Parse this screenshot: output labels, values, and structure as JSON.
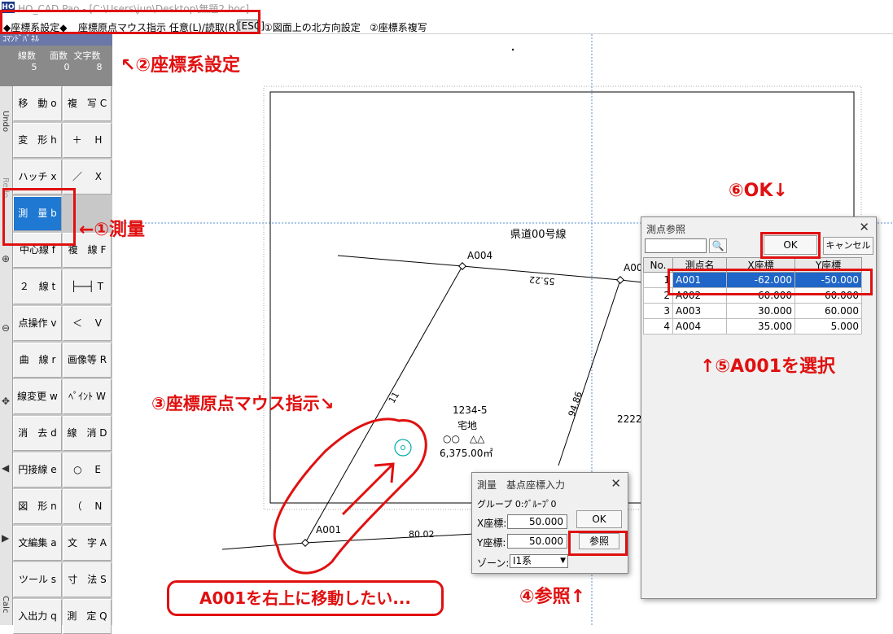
{
  "window": {
    "title": "HO_CAD Pao - [C:\\Users\\jun\\Desktop\\無題2.hoc]"
  },
  "prompt": {
    "mode": "◆座標系設定◆",
    "instruction": "座標原点マウス指示 任意(L)/読取(R)",
    "esc": "[ESC]",
    "opt1": "①図面上の北方向設定",
    "opt2": "②座標系複写"
  },
  "panel": {
    "label": "ｺﾏﾝﾄﾞﾊﾟﾈﾙ",
    "counts": [
      {
        "label": "線数",
        "value": "5"
      },
      {
        "label": "面数",
        "value": "0"
      },
      {
        "label": "文字数",
        "value": "8"
      }
    ]
  },
  "side_tabs": {
    "undo": "Undo",
    "redo": "Redo",
    "calc": "Calc"
  },
  "commands": [
    [
      "移　動 o",
      "複　写 C"
    ],
    [
      "変　形 h",
      "＋　 H"
    ],
    [
      "ハッチ x",
      "／　 X"
    ],
    [
      "測　量 b",
      ""
    ],
    [
      "中心線 f",
      "複　線 F"
    ],
    [
      "２　線 t",
      "├──┤ T"
    ],
    [
      "点操作 v",
      "＜　 V"
    ],
    [
      "曲　線 r",
      "画像等 R"
    ],
    [
      "線変更 w",
      "ﾍﾟｲﾝﾄ W"
    ],
    [
      "消　去 d",
      "線　消 D"
    ],
    [
      "円接線 e",
      "○　 E"
    ],
    [
      "図　形 n",
      "（　 N"
    ],
    [
      "文編集 a",
      "文　字 A"
    ],
    [
      "ツール s",
      "寸　法 S"
    ],
    [
      "入出力 q",
      "測　定 Q"
    ]
  ],
  "drawing": {
    "road": "県道00号線",
    "points": {
      "a001": "A001",
      "a004": "A004",
      "a00x": "A00"
    },
    "dims": {
      "top": "55.22",
      "right": "94.86",
      "left": "11",
      "bottom": "80.02"
    },
    "lot": {
      "number": "1234-5",
      "use": "宅地",
      "symbols": "○○　△△",
      "area": "6,375.00㎡"
    },
    "partial": "2222"
  },
  "base_dialog": {
    "title": "測量　基点座標入力",
    "group": "グループ 0:ｸﾞﾙｰﾌﾟ0",
    "x_label": "X座標:",
    "x_value": "50.000",
    "y_label": "Y座標:",
    "y_value": "50.000",
    "zone_label": "ゾーン:",
    "zone_value": "Ⅰ1系",
    "ok": "OK",
    "ref": "参照"
  },
  "point_dialog": {
    "title": "測点参照",
    "ok": "OK",
    "cancel": "キャンセル",
    "headers": [
      "No.",
      "測点名",
      "X座標",
      "Y座標"
    ],
    "rows": [
      [
        "1",
        "A001",
        "-62.000",
        "-50.000"
      ],
      [
        "2",
        "A002",
        "60.000",
        "60.000"
      ],
      [
        "3",
        "A003",
        "30.000",
        "60.000"
      ],
      [
        "4",
        "A004",
        "35.000",
        "5.000"
      ]
    ]
  },
  "annotations": {
    "a1": "←①測量",
    "a2": "↖②座標系設定",
    "a3": "③座標原点マウス指示↘",
    "a4": "④参照↑",
    "a5": "↑⑤A001を選択",
    "a6": "⑥OK↓",
    "bubble": "A001を右上に移動したい..."
  },
  "colors": {
    "annotation": "#e01010",
    "selection": "#1f66c8",
    "active_cmd": "#1f78d2"
  }
}
